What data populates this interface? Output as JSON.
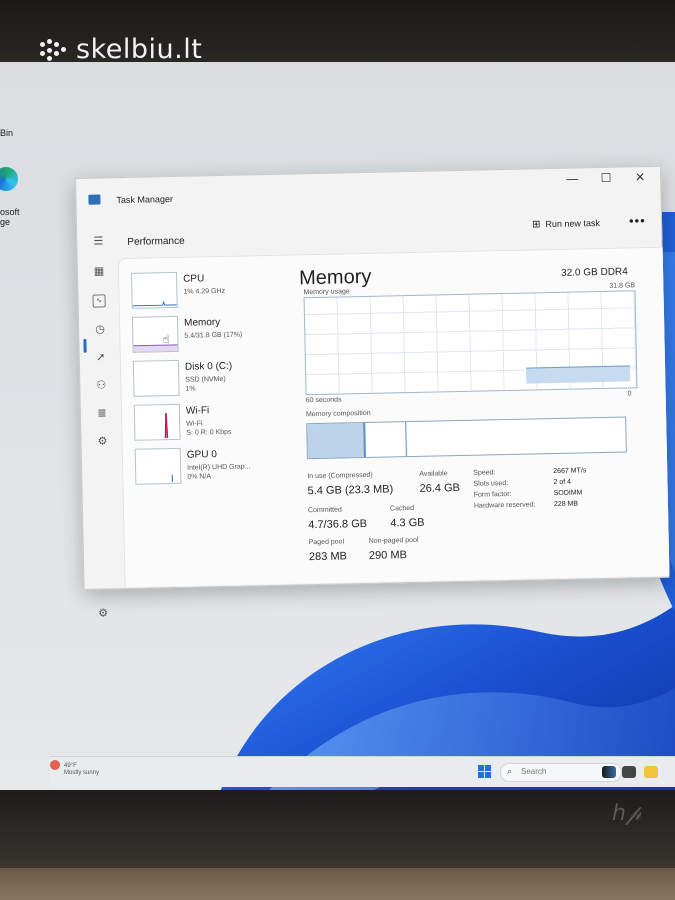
{
  "watermark": {
    "text": "skelbiu.lt"
  },
  "desktop": {
    "icons": [
      {
        "label": "Bin"
      },
      {
        "label": "osoft\nge"
      }
    ]
  },
  "taskbar": {
    "weather_line1": "49°F",
    "weather_line2": "Mostly sunny",
    "search_placeholder": "Search",
    "icons": [
      "start-icon",
      "search-icon",
      "media-icon",
      "explorer-icon"
    ]
  },
  "window": {
    "title": "Task Manager",
    "controls": [
      "—",
      "☐",
      "✕"
    ],
    "header": {
      "section_title": "Performance",
      "run_new_task": "Run new task",
      "more": "•••"
    },
    "devices": [
      {
        "name": "CPU",
        "sub1": "1% 4.29 GHz",
        "sub2": "",
        "accent": "#2b6cc4"
      },
      {
        "name": "Memory",
        "sub1": "5.4/31.8 GB (17%)",
        "sub2": "",
        "accent": "#8b5bb5"
      },
      {
        "name": "Disk 0 (C:)",
        "sub1": "SSD (NVMe)",
        "sub2": "1%",
        "accent": "#2e8b57"
      },
      {
        "name": "Wi-Fi",
        "sub1": "Wi-Fi",
        "sub2": "S: 0 R: 0 Kbps",
        "accent": "#c2185b"
      },
      {
        "name": "GPU 0",
        "sub1": "Intel(R) UHD Grap...",
        "sub2": "0% N/A",
        "accent": "#1565c0"
      }
    ],
    "memory": {
      "title": "Memory",
      "total": "32.0 GB DDR4",
      "usage_label": "Memory usage",
      "usage_max": "31.8 GB",
      "seconds_label": "60 seconds",
      "zero_label": "0",
      "composition_label": "Memory composition",
      "usage_fraction": 0.17,
      "stats": {
        "in_use_label": "In use (Compressed)",
        "in_use_value": "5.4 GB (23.3 MB)",
        "available_label": "Available",
        "available_value": "26.4 GB",
        "committed_label": "Committed",
        "committed_value": "4.7/36.8 GB",
        "cached_label": "Cached",
        "cached_value": "4.3 GB",
        "paged_label": "Paged pool",
        "paged_value": "283 MB",
        "nonpaged_label": "Non-paged pool",
        "nonpaged_value": "290 MB"
      },
      "specs": {
        "speed_label": "Speed:",
        "speed_value": "2667 MT/s",
        "slots_label": "Slots used:",
        "slots_value": "2 of 4",
        "form_label": "Form factor:",
        "form_value": "SODIMM",
        "reserved_label": "Hardware reserved:",
        "reserved_value": "228 MB"
      }
    }
  },
  "colors": {
    "accent_blue": "#2b6cc4",
    "graph_fill": "#c6daf0",
    "graph_border": "#9fb8cc",
    "wallpaper": "#1d5fd6"
  }
}
